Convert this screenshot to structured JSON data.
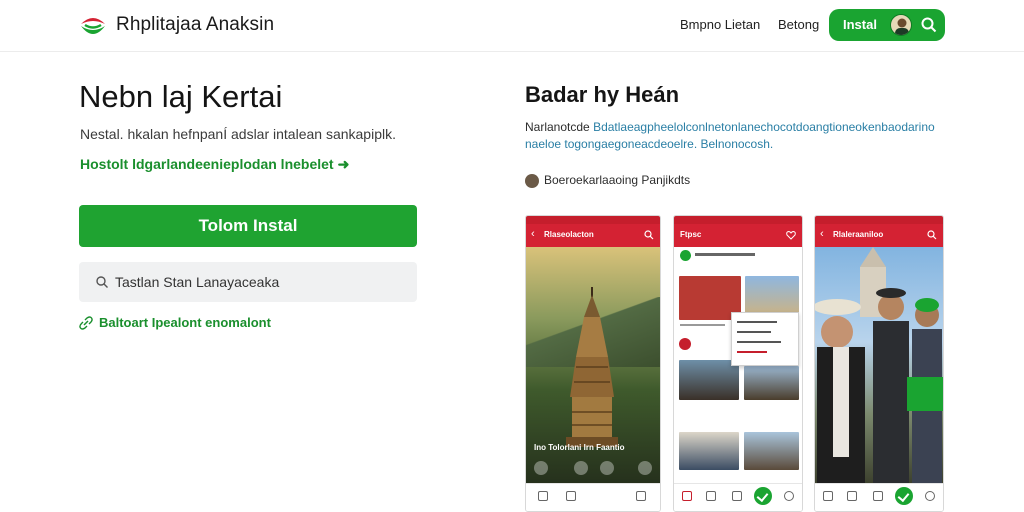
{
  "header": {
    "brand": "Rhplitajaa Anaksin",
    "nav": [
      "Bmpno Lietan",
      "Betong"
    ],
    "install_label": "Instal"
  },
  "hero": {
    "title": "Nebn laj Kertai",
    "description": "Nestal. hkalan hefnpanÍ adslar intalean sankapiplk.",
    "link": "Hostolt ldgarlandeenieplodan lnebelet",
    "link_arrow": "➜",
    "install_button": "Tolom Instal",
    "search_placeholder": "Tastlan Stan Lanayaceaka",
    "secondary_link": "Baltoart Ipealont enomalont"
  },
  "app": {
    "title": "Badar hy Heán",
    "description_lead": "Narlanotcde",
    "description_body": "Bdatlaeagpheelolconlnetonlanechocotdoangtioneokenbaodarino",
    "description_line2": "naeloe togongaegoneacdeoelre.",
    "description_tail": "Belnonocosh.",
    "developer": "Boeroekarlaaoing Panjikdts"
  },
  "phones": [
    {
      "appbar_title": "Rlaseolacton",
      "caption": "Ino Tolorlani Irn Faantio"
    },
    {
      "appbar_title": "Ftpsc"
    },
    {
      "appbar_title": "Rlaleraaniloo"
    }
  ],
  "colors": {
    "accent_green": "#1fa331",
    "app_red": "#d42233",
    "link_blue": "#2a7fa5"
  }
}
